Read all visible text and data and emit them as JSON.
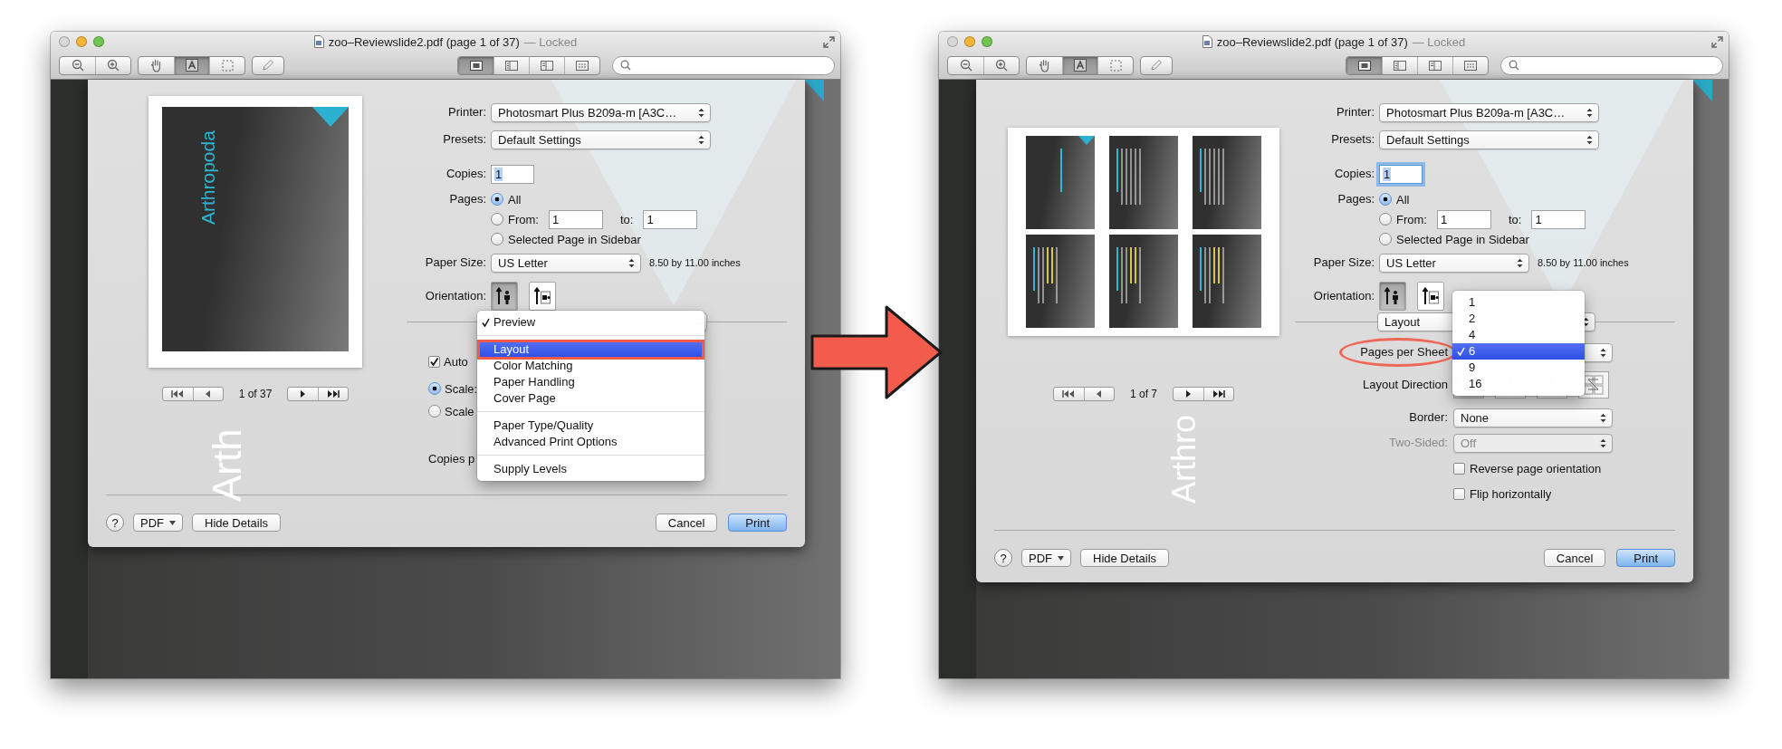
{
  "windows": [
    {
      "title": "zoo–Reviewslide2.pdf (page 1 of 37)",
      "title_status": "— Locked",
      "tools": [
        {
          "kind": "hand",
          "selected": false
        },
        {
          "kind": "text",
          "selected": true
        },
        {
          "kind": "select",
          "selected": false
        }
      ],
      "views": [
        {
          "kind": "content",
          "selected": true
        },
        {
          "kind": "thumbnails",
          "selected": false
        },
        {
          "kind": "toc",
          "selected": false
        },
        {
          "kind": "contact",
          "selected": false
        }
      ],
      "watermark": "Arth",
      "preview": {
        "kind": "single",
        "slide_title": "Arthropoda",
        "page_counter": "1 of 37"
      },
      "form": {
        "printer_label": "Printer:",
        "printer": "Photosmart Plus B209a-m [A3C…",
        "presets_label": "Presets:",
        "presets": "Default Settings",
        "copies_label": "Copies:",
        "copies": "1",
        "copies_focused": false,
        "pages_label": "Pages:",
        "pages_options": [
          {
            "kind": "plain",
            "label": "All",
            "selected": true
          },
          {
            "kind": "range",
            "label": "From:",
            "selected": false,
            "from": "1",
            "to_label": "to:",
            "to": "1"
          },
          {
            "kind": "plain",
            "label": "Selected Page in Sidebar",
            "selected": false
          }
        ],
        "paper_size_label": "Paper Size:",
        "paper_size": "US Letter",
        "paper_size_note": "8.50 by 11.00 inches",
        "orientation_label": "Orientation:",
        "orientation": [
          {
            "kind": "portrait",
            "selected": true
          },
          {
            "kind": "landscape",
            "selected": false
          }
        ]
      },
      "section": {
        "kind": "scaling",
        "rows": [
          {
            "kind": "checkbox",
            "label": "Auto",
            "checked": true
          },
          {
            "kind": "radio",
            "label": "Scale:",
            "selected": true
          },
          {
            "kind": "radio",
            "label": "Scale",
            "selected": false
          },
          {
            "kind": "text",
            "label": "Copies p"
          }
        ],
        "menu": {
          "groups": [
            [
              {
                "label": "Preview",
                "checked": true,
                "selected": false,
                "callout": false
              }
            ],
            [
              {
                "label": "Layout",
                "checked": false,
                "selected": true,
                "callout": true
              },
              {
                "label": "Color Matching",
                "checked": false,
                "selected": false,
                "callout": false
              },
              {
                "label": "Paper Handling",
                "checked": false,
                "selected": false,
                "callout": false
              },
              {
                "label": "Cover Page",
                "checked": false,
                "selected": false,
                "callout": false
              }
            ],
            [
              {
                "label": "Paper Type/Quality",
                "checked": false,
                "selected": false,
                "callout": false
              },
              {
                "label": "Advanced Print Options",
                "checked": false,
                "selected": false,
                "callout": false
              }
            ],
            [
              {
                "label": "Supply Levels",
                "checked": false,
                "selected": false,
                "callout": false
              }
            ]
          ]
        }
      },
      "footer": {
        "help": "?",
        "pdf": "PDF",
        "hide_details": "Hide Details",
        "cancel": "Cancel",
        "print": "Print"
      }
    },
    {
      "title": "zoo–Reviewslide2.pdf (page 1 of 37)",
      "title_status": "— Locked",
      "tools": [
        {
          "kind": "hand",
          "selected": false
        },
        {
          "kind": "text",
          "selected": true
        },
        {
          "kind": "select",
          "selected": false
        }
      ],
      "views": [
        {
          "kind": "content",
          "selected": true
        },
        {
          "kind": "thumbnails",
          "selected": false
        },
        {
          "kind": "toc",
          "selected": false
        },
        {
          "kind": "contact",
          "selected": false
        }
      ],
      "watermark": "Arthro",
      "preview": {
        "kind": "grid",
        "page_counter": "1 of 7"
      },
      "form": {
        "printer_label": "Printer:",
        "printer": "Photosmart Plus B209a-m [A3C…",
        "presets_label": "Presets:",
        "presets": "Default Settings",
        "copies_label": "Copies:",
        "copies": "1",
        "copies_focused": true,
        "pages_label": "Pages:",
        "pages_options": [
          {
            "kind": "plain",
            "label": "All",
            "selected": true
          },
          {
            "kind": "range",
            "label": "From:",
            "selected": false,
            "from": "1",
            "to_label": "to:",
            "to": "1"
          },
          {
            "kind": "plain",
            "label": "Selected Page in Sidebar",
            "selected": false
          }
        ],
        "paper_size_label": "Paper Size:",
        "paper_size": "US Letter",
        "paper_size_note": "8.50 by 11.00 inches",
        "orientation_label": "Orientation:",
        "orientation": [
          {
            "kind": "portrait",
            "selected": true
          },
          {
            "kind": "landscape",
            "selected": false
          }
        ]
      },
      "section": {
        "kind": "layout",
        "panel_popup": "Layout",
        "rows": [
          {
            "kind": "popup_menu",
            "label": "Pages per Sheet",
            "callout": true,
            "options": [
              {
                "label": "1",
                "selected": false
              },
              {
                "label": "2",
                "selected": false
              },
              {
                "label": "4",
                "selected": false
              },
              {
                "label": "6",
                "selected": true
              },
              {
                "label": "9",
                "selected": false
              },
              {
                "label": "16",
                "selected": false
              }
            ]
          },
          {
            "kind": "direction",
            "label": "Layout Direction"
          },
          {
            "kind": "popup",
            "label": "Border:",
            "value": "None",
            "disabled": false
          },
          {
            "kind": "popup",
            "label": "Two-Sided:",
            "value": "Off",
            "disabled": true
          },
          {
            "kind": "checkbox",
            "label": "Reverse page orientation",
            "checked": false
          },
          {
            "kind": "checkbox",
            "label": "Flip horizontally",
            "checked": false
          }
        ]
      },
      "footer": {
        "help": "?",
        "pdf": "PDF",
        "hide_details": "Hide Details",
        "cancel": "Cancel",
        "print": "Print"
      }
    }
  ]
}
